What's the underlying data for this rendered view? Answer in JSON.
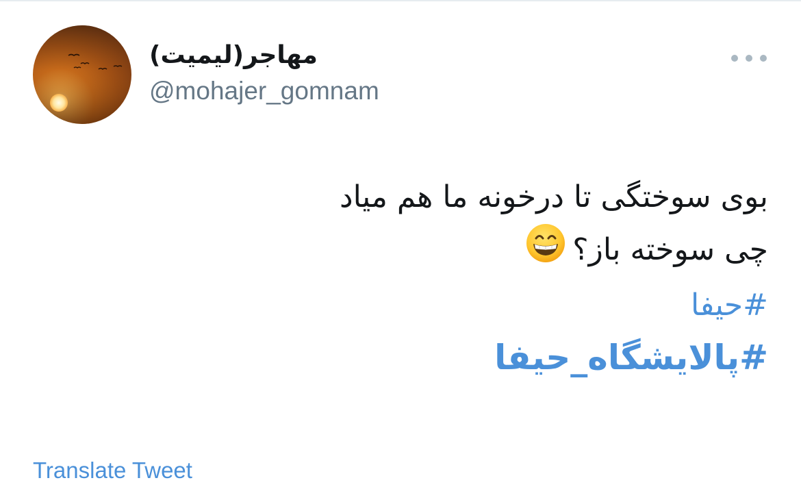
{
  "user": {
    "display_name": "مهاجر(لیمیت)",
    "handle": "@mohajer_gomnam",
    "avatar_icon": "sunset-birds-avatar"
  },
  "menu": {
    "icon": "more-horizontal-icon"
  },
  "tweet": {
    "line1": "بوی سوختگی تا درخونه ما هم میاد",
    "line2": "چی سوخته باز؟",
    "emoji": "grinning-face-emoji",
    "hashtag1": "#حیفا",
    "hashtag2": "#پالایشگاه_حیفا"
  },
  "actions": {
    "translate_label": "Translate Tweet"
  },
  "colors": {
    "link": "#4a90d9",
    "text": "#14171a",
    "muted": "#657786"
  }
}
